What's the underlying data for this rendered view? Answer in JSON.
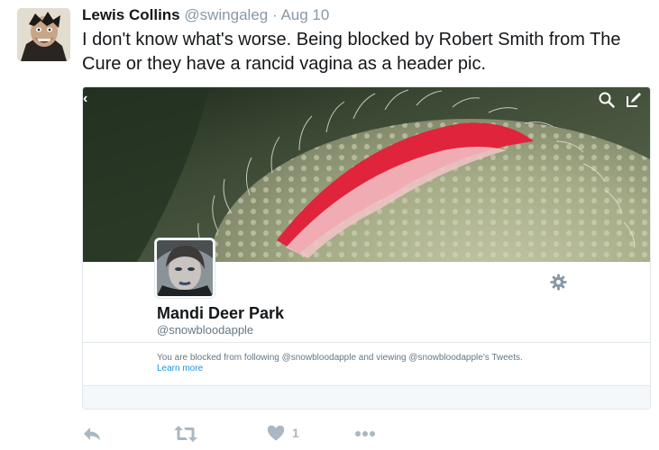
{
  "tweet": {
    "author_name": "Lewis Collins",
    "author_handle": "@swingaleg",
    "separator": "·",
    "date": "Aug 10",
    "text": "I don't know what's worse. Being blocked by Robert Smith from The Cure or they have a rancid vagina as a header pic."
  },
  "card": {
    "back_chevron": "‹",
    "profile_name": "Mandi Deer Park",
    "profile_handle": "@snowbloodapple",
    "blocked_message": "You are blocked from following @snowbloodapple and viewing @snowbloodapple's Tweets.",
    "learn_more_label": "Learn more",
    "icons": [
      "search-icon",
      "compose-icon",
      "gear-icon"
    ]
  },
  "actions": {
    "like_count": "1",
    "icons": [
      "reply-icon",
      "retweet-icon",
      "heart-icon",
      "more-icon"
    ]
  },
  "colors": {
    "name": "#14171a",
    "muted": "#8899a6",
    "link": "#1b95e0",
    "action_icon": "#aab8c2",
    "border": "#e1e8ed"
  }
}
